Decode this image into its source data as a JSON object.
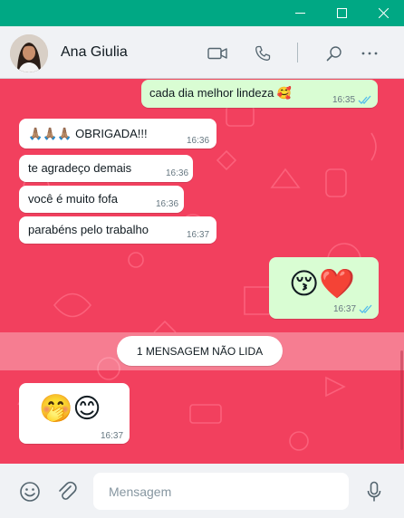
{
  "window": {
    "controls": [
      {
        "icon": "minimize-icon"
      },
      {
        "icon": "maximize-icon"
      },
      {
        "icon": "close-icon"
      }
    ]
  },
  "header": {
    "contact_name": "Ana Giulia",
    "icons": [
      "video-call-icon",
      "voice-call-icon",
      "search-icon",
      "more-options-icon"
    ]
  },
  "messages": [
    {
      "direction": "outgoing",
      "text": "cada dia melhor lindeza 🥰",
      "time": "16:35",
      "status": "read"
    },
    {
      "direction": "incoming",
      "text": "🙏🏽🙏🏽🙏🏽 OBRIGADA!!!",
      "time": "16:36"
    },
    {
      "direction": "incoming",
      "text": "te agradeço demais",
      "time": "16:36"
    },
    {
      "direction": "incoming",
      "text": "você é muito fofa",
      "time": "16:36"
    },
    {
      "direction": "incoming",
      "text": "parabéns pelo trabalho",
      "time": "16:37"
    },
    {
      "direction": "outgoing",
      "text": "😚❤️",
      "time": "16:37",
      "status": "read"
    },
    {
      "direction": "incoming",
      "text": "🤭😊",
      "time": "16:37"
    }
  ],
  "unread_divider": "1 MENSAGEM NÃO LIDA",
  "composer": {
    "placeholder": "Mensagem",
    "icons": [
      "emoji-icon",
      "attach-icon",
      "microphone-icon"
    ]
  },
  "colors": {
    "title_bar": "#00a884",
    "chat_background": "#f2405e",
    "outgoing_bubble": "#d9fdd3",
    "incoming_bubble": "#ffffff",
    "read_tick": "#53bdeb"
  }
}
